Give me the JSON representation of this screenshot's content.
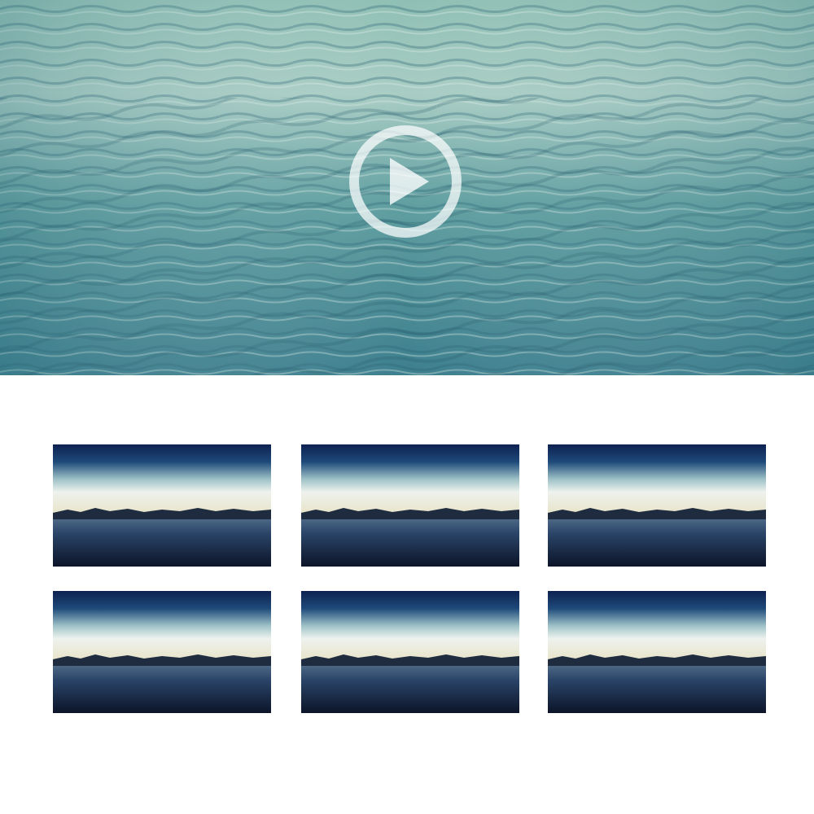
{
  "hero": {
    "play_icon": "play-circle-icon",
    "colors": {
      "water_light": "#a9cdc4",
      "water_mid": "#5f9ea0",
      "water_dark": "#2f6f7e",
      "play_overlay": "#ffffff"
    }
  },
  "thumbnails": {
    "count": 6,
    "colors": {
      "sky_top": "#0d2150",
      "horizon_glow": "#eef2ee",
      "mountains": "#1f2c40",
      "water_bottom": "#0c1428"
    }
  }
}
